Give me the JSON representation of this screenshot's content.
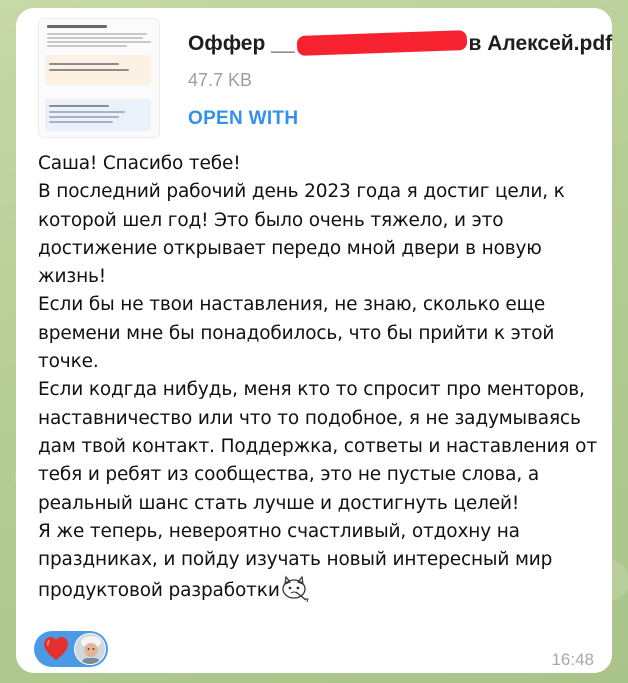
{
  "file": {
    "name_prefix": "Оффер __",
    "name_suffix": "в Алексей.pdf",
    "size": "47.7 KB",
    "action_label": "OPEN WITH"
  },
  "message": {
    "paragraphs": [
      "Саша! Спасибо тебе!",
      "В последний рабочий день 2023 года я достиг цели, к которой шел год! Это было очень тяжело, и это достижение открывает передо мной двери в новую жизнь!",
      "Если бы не твои наставления, не знаю, сколько еще времени мне бы понадобилось, что бы прийти к этой точке.",
      "Если кодгда нибудь, меня кто то спросит про менторов, наставничество или что то подобное, я не задумываясь дам твой контакт. Поддержка, сответы и наставления от тебя и ребят из сообщества, это не пустые слова, а реальный шанс стать лучше и достигнуть целей!",
      "Я же теперь, невероятно счастливый, отдохну на праздниках, и пойду изучать новый интересный мир продуктовой разработки"
    ],
    "trailing_emoji": "sticker-cat-emoji"
  },
  "reactions": {
    "emoji": "heart-icon",
    "user": "avatar"
  },
  "timestamp": "16:48",
  "colors": {
    "accent": "#3390ec",
    "reaction_bg": "#4a9ae6",
    "redaction": "#f7222f",
    "background": "#b9cf9b"
  }
}
